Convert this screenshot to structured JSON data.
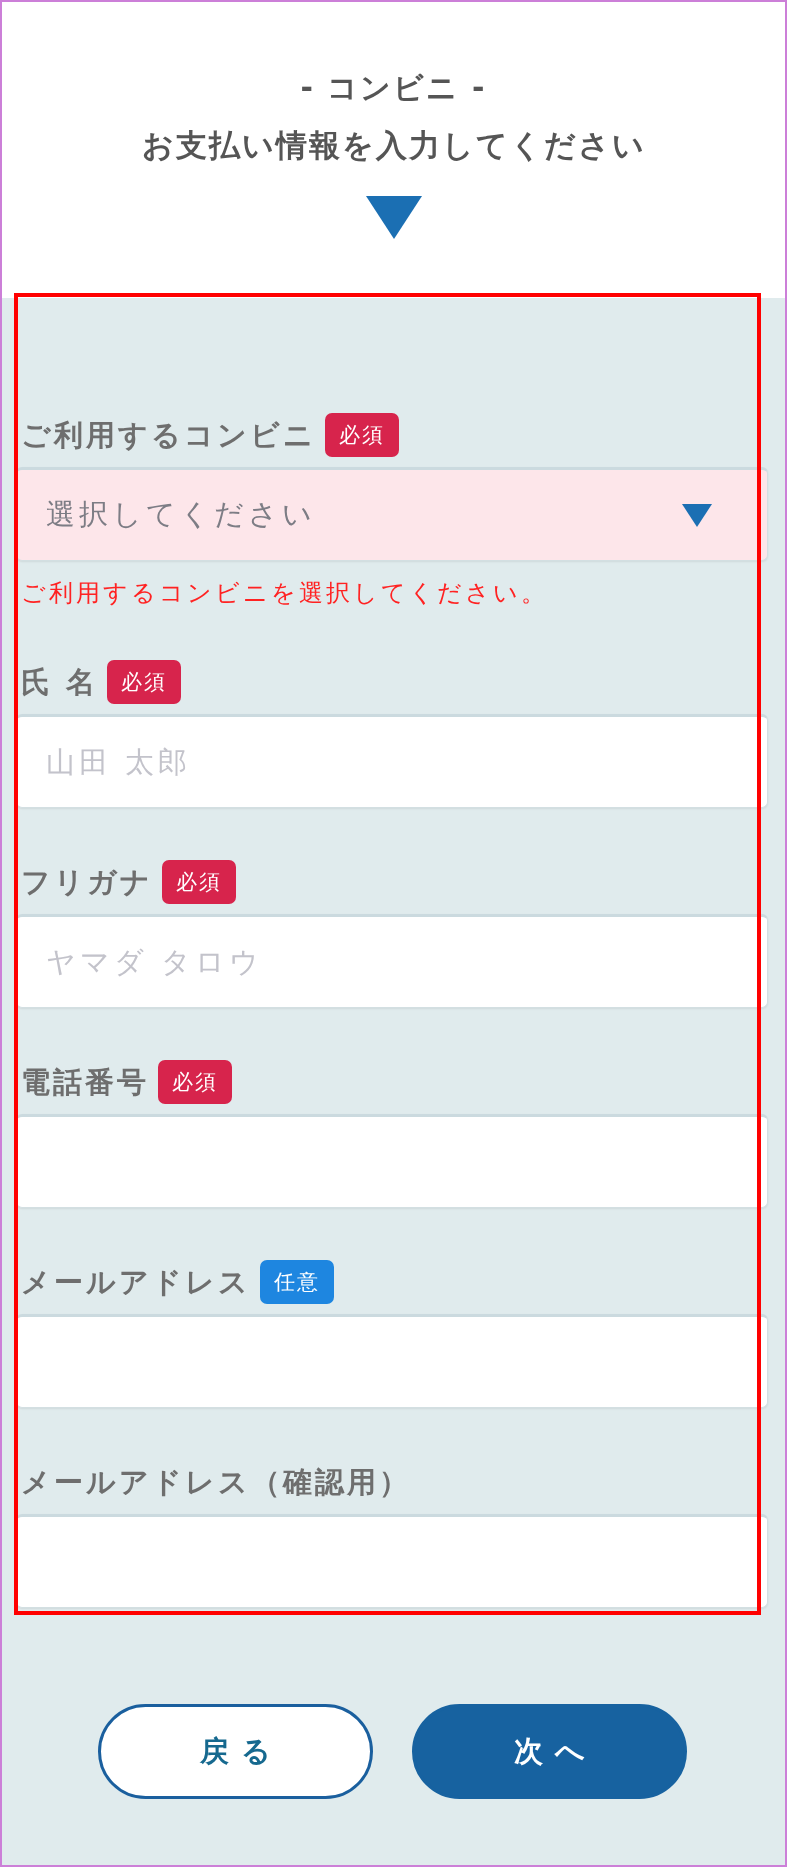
{
  "header": {
    "subtitle": "- コンビニ -",
    "title": "お支払い情報を入力してください"
  },
  "form": {
    "fields": [
      {
        "kind": "select",
        "label": "ご利用するコンビニ",
        "badge": {
          "kind": "required",
          "text": "必須"
        },
        "placeholder": "選択してください",
        "invalid": true,
        "error": "ご利用するコンビニを選択してください。"
      },
      {
        "kind": "text",
        "label": "氏 名",
        "badge": {
          "kind": "required",
          "text": "必須"
        },
        "placeholder": "山田 太郎",
        "invalid": false
      },
      {
        "kind": "text",
        "label": "フリガナ",
        "badge": {
          "kind": "required",
          "text": "必須"
        },
        "placeholder": "ヤマダ タロウ",
        "invalid": false
      },
      {
        "kind": "text",
        "label": "電話番号",
        "badge": {
          "kind": "required",
          "text": "必須"
        },
        "invalid": false
      },
      {
        "kind": "text",
        "label": "メールアドレス",
        "badge": {
          "kind": "optional",
          "text": "任意"
        },
        "invalid": false
      },
      {
        "kind": "text",
        "label": "メールアドレス（確認用）",
        "invalid": false
      }
    ]
  },
  "buttons": [
    {
      "kind": "secondary",
      "label": "戻る"
    },
    {
      "kind": "primary",
      "label": "次へ"
    }
  ]
}
